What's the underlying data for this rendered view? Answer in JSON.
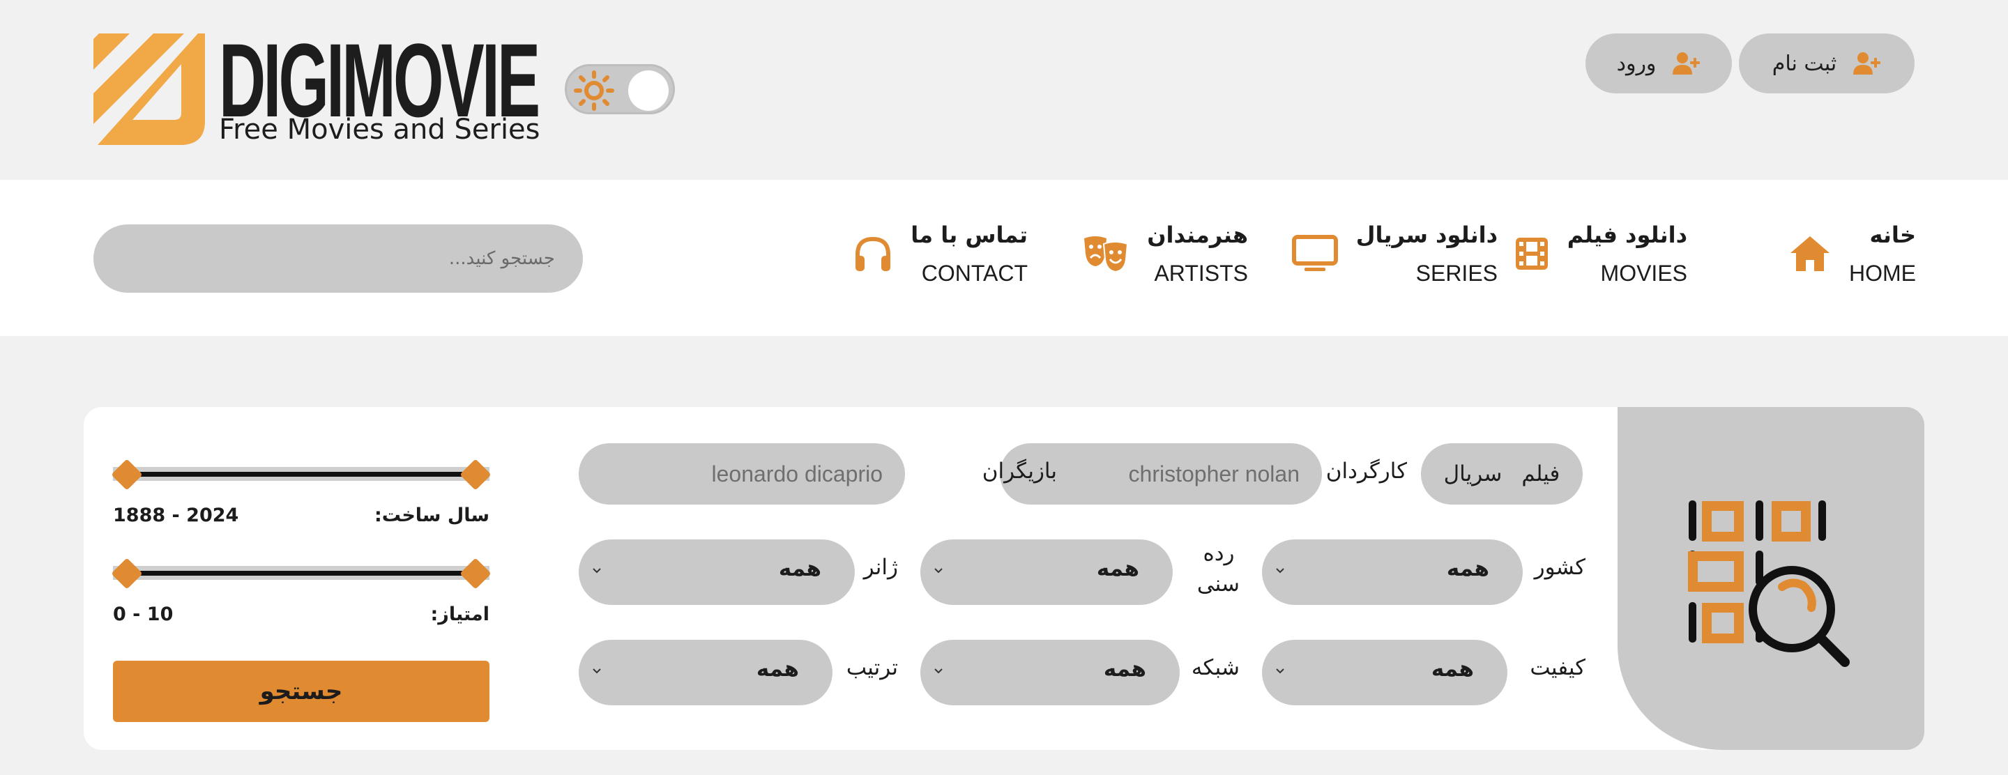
{
  "brand": {
    "name": "DIGIMOVIE",
    "tagline": "Free Movies and Series",
    "accent": "#e08a32",
    "logo_color": "#f0a946"
  },
  "header": {
    "theme_toggle_icon": "sun-icon",
    "register_label": "ثبت نام",
    "login_label": "ورود",
    "user_icon": "user-plus-icon"
  },
  "nav": {
    "items": [
      {
        "fa": "خانه",
        "en": "HOME",
        "icon": "home-icon"
      },
      {
        "fa": "دانلود فیلم",
        "en": "MOVIES",
        "icon": "film-icon"
      },
      {
        "fa": "دانلود سریال",
        "en": "SERIES",
        "icon": "tv-icon"
      },
      {
        "fa": "هنرمندان",
        "en": "ARTISTS",
        "icon": "theater-masks-icon"
      },
      {
        "fa": "تماس با ما",
        "en": "CONTACT",
        "icon": "headphones-icon"
      }
    ],
    "search_placeholder": "جستجو کنید..."
  },
  "filters": {
    "type_options": [
      "فیلم",
      "سریال"
    ],
    "director_label": "کارگردان",
    "director_value": "christopher nolan",
    "actors_label": "بازیگران",
    "actors_value": "leonardo dicaprio",
    "country_label": "کشور",
    "country_value": "همه",
    "age_rating_label": "رده سنی",
    "age_rating_value": "همه",
    "genre_label": "ژانر",
    "genre_value": "همه",
    "quality_label": "کیفیت",
    "quality_value": "همه",
    "network_label": "شبکه",
    "network_value": "همه",
    "sort_label": "ترتیب",
    "sort_value": "همه",
    "year_label": "سال ساخت:",
    "year_range": "1888 - 2024",
    "year_min": 1888,
    "year_max": 2024,
    "rating_label": "امتیاز:",
    "rating_range": "0 - 10",
    "rating_min": 0,
    "rating_max": 10,
    "submit_label": "جستجو",
    "art_icon": "advanced-search-icon"
  }
}
